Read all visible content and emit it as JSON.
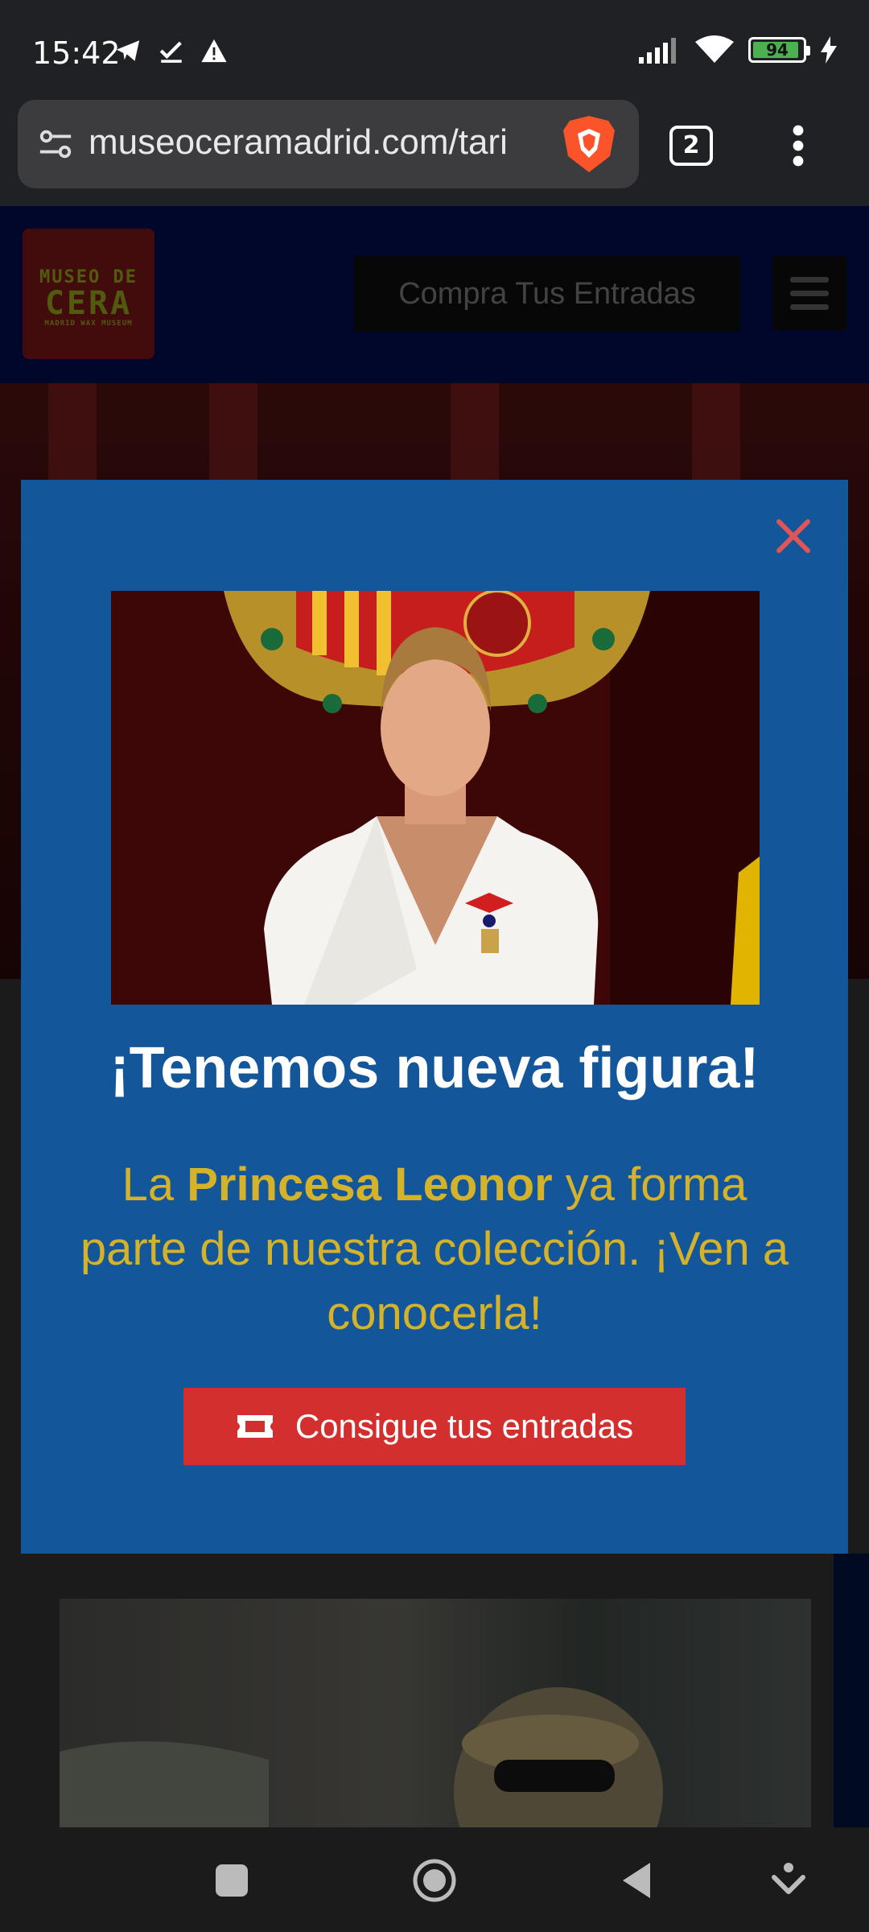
{
  "status_bar": {
    "time": "15:42",
    "battery_level": 94,
    "battery_label": "94",
    "icons": [
      "telegram-icon",
      "check-icon",
      "warning-icon",
      "signal-icon",
      "wifi-icon",
      "battery-icon",
      "charging-icon"
    ]
  },
  "browser": {
    "url": "museoceramadrid.com/tari",
    "tab_count": "2"
  },
  "site_header": {
    "logo_line1": "MUSEO DE",
    "logo_line2": "CERA",
    "logo_line3": "MADRID WAX MUSEUM",
    "buy_button": "Compra Tus Entradas"
  },
  "modal": {
    "title": "¡Tenemos nueva figura!",
    "text_prefix": "La ",
    "text_bold": "Princesa Leonor",
    "text_suffix": " ya forma parte de nuestra colección. ¡Ven a conocerla!",
    "cta_label": "Consigue tus entradas"
  },
  "colors": {
    "modal_bg": "#14569a",
    "title": "#ffffff",
    "body_text": "#d4b22a",
    "cta_bg": "#d32f2f",
    "close": "#e05555"
  }
}
